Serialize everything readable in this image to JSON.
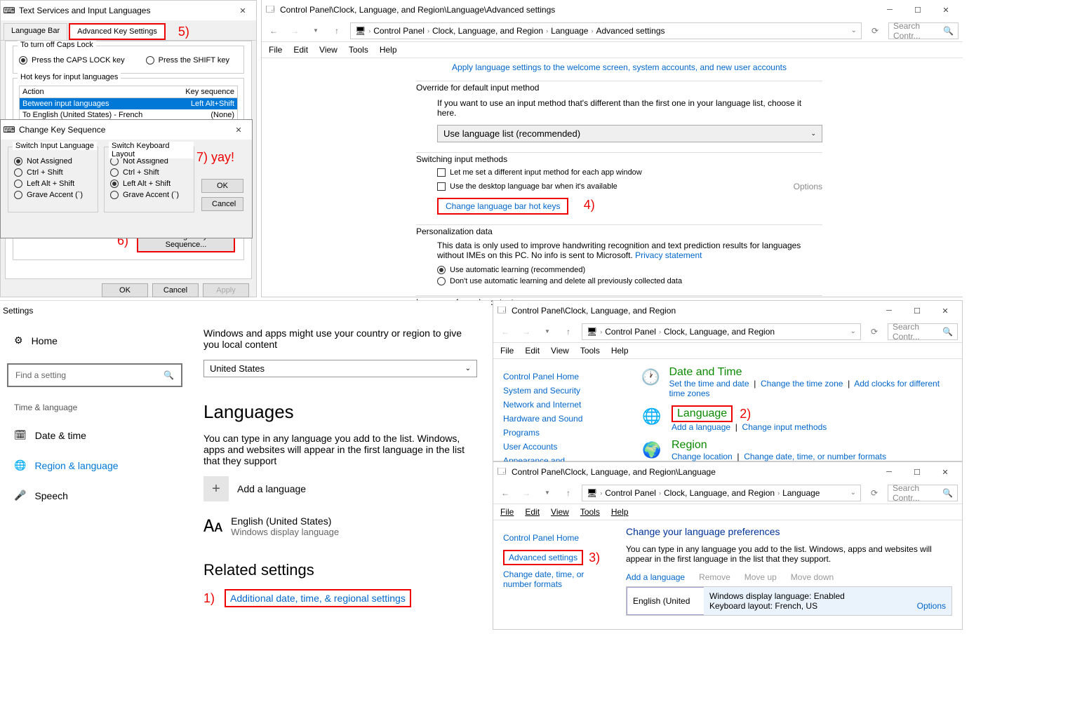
{
  "annotations": {
    "a1": "1)",
    "a2": "2)",
    "a3": "3)",
    "a4": "4)",
    "a5": "5)",
    "a6": "6)",
    "a7": "7) yay!"
  },
  "textservices": {
    "title": "Text Services and Input Languages",
    "tabs": {
      "langbar": "Language Bar",
      "advkey": "Advanced Key Settings"
    },
    "capslock_group": "To turn off Caps Lock",
    "capslock_caps": "Press the CAPS LOCK key",
    "capslock_shift": "Press the SHIFT key",
    "hotkeys_group": "Hot keys for input languages",
    "col_action": "Action",
    "col_keyseq": "Key sequence",
    "row1_action": "Between input languages",
    "row1_key": "Left Alt+Shift",
    "row2_action": "To English (United States) - French",
    "row2_key": "(None)",
    "change_seq_btn": "Change Key Sequence...",
    "ok": "OK",
    "cancel": "Cancel",
    "apply": "Apply"
  },
  "changekey": {
    "title": "Change Key Sequence",
    "switch_input": "Switch Input Language",
    "switch_layout": "Switch Keyboard Layout",
    "not_assigned": "Not Assigned",
    "ctrl_shift": "Ctrl + Shift",
    "left_alt_shift": "Left Alt + Shift",
    "grave": "Grave Accent (`)",
    "ok": "OK",
    "cancel": "Cancel"
  },
  "advset": {
    "title": "Control Panel\\Clock, Language, and Region\\Language\\Advanced settings",
    "crumbs": [
      "Control Panel",
      "Clock, Language, and Region",
      "Language",
      "Advanced settings"
    ],
    "search_ph": "Search Contr...",
    "menus": [
      "File",
      "Edit",
      "View",
      "Tools",
      "Help"
    ],
    "welcome_link": "Apply language settings to the welcome screen, system accounts, and new user accounts",
    "override_h": "Override for default input method",
    "override_desc": "If you want to use an input method that's different than the first one in your language list, choose it here.",
    "override_combo": "Use language list (recommended)",
    "switching_h": "Switching input methods",
    "chk_diff": "Let me set a different input method for each app window",
    "chk_desktop": "Use the desktop language bar when it's available",
    "options": "Options",
    "change_hotkeys": "Change language bar hot keys",
    "pers_h": "Personalization data",
    "pers_desc": "This data is only used to improve handwriting recognition and text prediction results for languages without IMEs on this PC. No info is sent to Microsoft. ",
    "privacy": "Privacy statement",
    "auto_learn": "Use automatic learning (recommended)",
    "no_learn": "Don't use automatic learning and delete all previously collected data",
    "web_h": "Language for web content"
  },
  "settings": {
    "title": "Settings",
    "home": "Home",
    "find_ph": "Find a setting",
    "group": "Time & language",
    "items": [
      "Date & time",
      "Region & language",
      "Speech"
    ],
    "region_desc": "Windows and apps might use your country or region to give you local content",
    "country": "United States",
    "languages_h": "Languages",
    "languages_desc": "You can type in any language you add to the list. Windows, apps and websites will appear in the first language in the list that they support",
    "add_lang": "Add a language",
    "eng_us": "English (United States)",
    "eng_disp": "Windows display language",
    "related_h": "Related settings",
    "additional": "Additional date, time, & regional settings"
  },
  "clr": {
    "title": "Control Panel\\Clock, Language, and Region",
    "crumbs": [
      "Control Panel",
      "Clock, Language, and Region"
    ],
    "search_ph": "Search Contr...",
    "menus": [
      "File",
      "Edit",
      "View",
      "Tools",
      "Help"
    ],
    "cph": "Control Panel Home",
    "side": [
      "System and Security",
      "Network and Internet",
      "Hardware and Sound",
      "Programs",
      "User Accounts",
      "Appearance and"
    ],
    "date_h": "Date and Time",
    "date_links": [
      "Set the time and date",
      "Change the time zone",
      "Add clocks for different time zones"
    ],
    "lang_h": "Language",
    "lang_links": [
      "Add a language",
      "Change input methods"
    ],
    "region_h": "Region",
    "region_links": [
      "Change location",
      "Change date, time, or number formats"
    ]
  },
  "langwin": {
    "title": "Control Panel\\Clock, Language, and Region\\Language",
    "crumbs": [
      "Control Panel",
      "Clock, Language, and Region",
      "Language"
    ],
    "search_ph": "Search Contr...",
    "menus": [
      "File",
      "Edit",
      "View",
      "Tools",
      "Help"
    ],
    "cph": "Control Panel Home",
    "advset": "Advanced settings",
    "change_fmt": "Change date, time, or number formats",
    "prefs_h": "Change your language preferences",
    "prefs_desc": "You can type in any language you add to the list. Windows, apps and websites will appear in the first language in the list that they support.",
    "toolbar": [
      "Add a language",
      "Remove",
      "Move up",
      "Move down"
    ],
    "item_name": "English (United",
    "item_l1": "Windows display language: Enabled",
    "item_l2": "Keyboard layout: French, US",
    "options": "Options"
  }
}
